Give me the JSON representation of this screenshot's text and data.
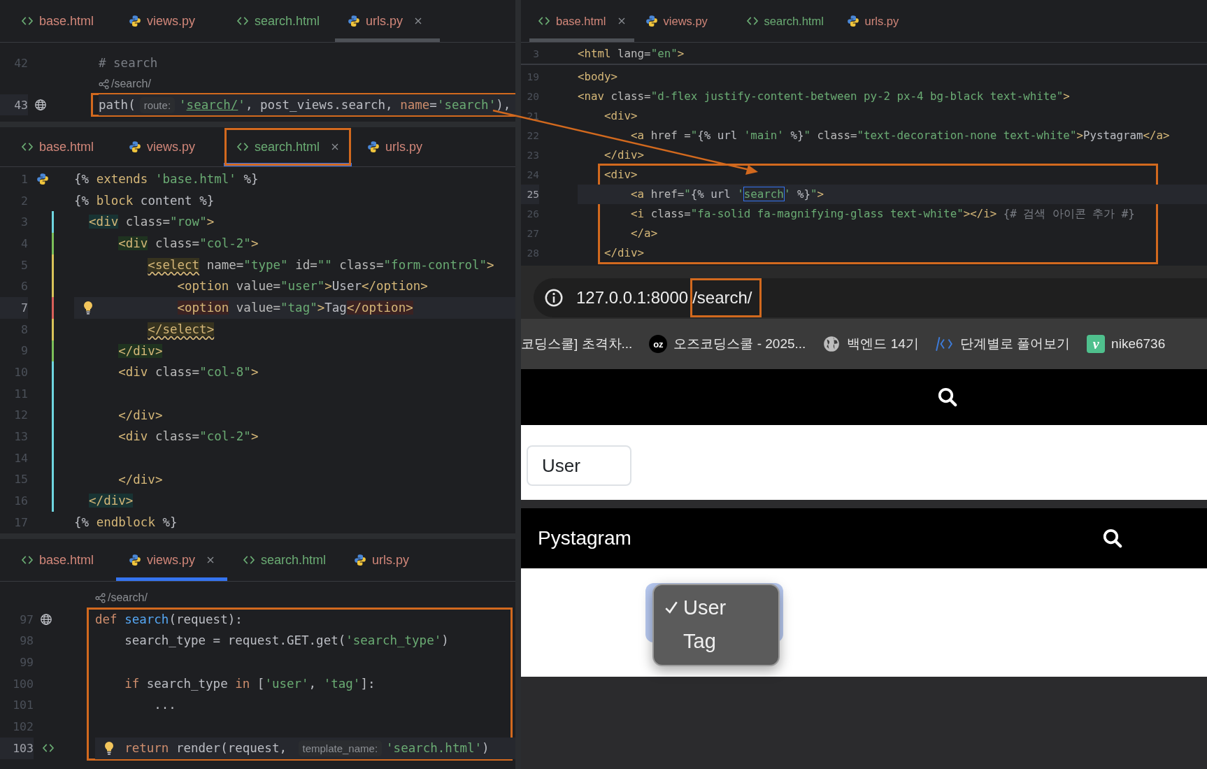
{
  "left_panes": [
    {
      "focused": false,
      "tabs": [
        {
          "label": "base.html",
          "kind": "html",
          "color": "#d2877a",
          "selected": false,
          "boxed": false
        },
        {
          "label": "views.py",
          "kind": "python",
          "color": "#d2877a",
          "selected": false,
          "boxed": false
        },
        {
          "label": "search.html",
          "kind": "html",
          "color": "#6aab73",
          "selected": false,
          "boxed": false
        },
        {
          "label": "urls.py",
          "kind": "python",
          "color": "#d2877a",
          "selected": true,
          "boxed": false
        }
      ],
      "blocks": [
        {
          "boxed": false,
          "lines": [
            {
              "num": "42",
              "current": false,
              "tokens": [
                {
                  "kind": "cmt",
                  "text": "# search"
                }
              ]
            },
            {
              "kind": "usage",
              "text": "/search/"
            }
          ]
        },
        {
          "boxed": true,
          "lines": [
            {
              "num": "43",
              "current": true,
              "markers": [
                {
                  "kind": "globe"
                }
              ],
              "tokens": [
                {
                  "kind": "plain",
                  "text": "path("
                },
                {
                  "kind": "hint",
                  "text": "route:"
                },
                {
                  "kind": "str",
                  "text": "'"
                },
                {
                  "kind": "str-u",
                  "text": "search/"
                },
                {
                  "kind": "str",
                  "text": "'"
                },
                {
                  "kind": "plain",
                  "text": ", post_views.search, "
                },
                {
                  "kind": "kw",
                  "text": "name"
                },
                {
                  "kind": "plain",
                  "text": "="
                },
                {
                  "kind": "str",
                  "text": "'search'"
                },
                {
                  "kind": "plain",
                  "text": "),"
                }
              ]
            }
          ]
        }
      ]
    },
    {
      "focused": true,
      "tabs": [
        {
          "label": "base.html",
          "kind": "html",
          "color": "#d2877a",
          "selected": false,
          "boxed": false
        },
        {
          "label": "views.py",
          "kind": "python",
          "color": "#d2877a",
          "selected": false,
          "boxed": false
        },
        {
          "label": "search.html",
          "kind": "html",
          "color": "#6aab73",
          "selected": true,
          "boxed": true
        },
        {
          "label": "urls.py",
          "kind": "python",
          "color": "#d2877a",
          "selected": false,
          "boxed": false
        }
      ],
      "blocks": [
        {
          "boxed": false,
          "lines": [
            {
              "num": "1",
              "current": false,
              "markers": [
                {
                  "kind": "python"
                }
              ],
              "tokens": [
                {
                  "kind": "plain",
                  "text": "{%"
                },
                {
                  "kind": "tag",
                  "text": " extends"
                },
                {
                  "kind": "str",
                  "text": " 'base.html'"
                },
                {
                  "kind": "plain",
                  "text": " %}"
                }
              ]
            },
            {
              "num": "2",
              "current": false,
              "tokens": [
                {
                  "kind": "plain",
                  "text": "{%"
                },
                {
                  "kind": "tag",
                  "text": " block"
                },
                {
                  "kind": "plain",
                  "text": " content %}"
                }
              ]
            },
            {
              "num": "3",
              "current": false,
              "color": "#6fd6e0",
              "tokens": [
                {
                  "kind": "tag-teal",
                  "text": "  <div"
                },
                {
                  "kind": "attr",
                  "text": " class="
                },
                {
                  "kind": "str",
                  "text": "\"row\""
                },
                {
                  "kind": "tag",
                  "text": ">"
                }
              ]
            },
            {
              "num": "4",
              "current": false,
              "color": "#7cbf5a",
              "tokens": [
                {
                  "kind": "tag-green",
                  "text": "      <div"
                },
                {
                  "kind": "attr",
                  "text": " class="
                },
                {
                  "kind": "str",
                  "text": "\"col-2\""
                },
                {
                  "kind": "tag",
                  "text": ">"
                }
              ]
            },
            {
              "num": "5",
              "current": false,
              "color": "#d9c45a",
              "tokens": [
                {
                  "kind": "tag-olive",
                  "text": "          <select"
                },
                {
                  "kind": "attr",
                  "text": " name="
                },
                {
                  "kind": "str",
                  "text": "\"type\""
                },
                {
                  "kind": "attr",
                  "text": " id="
                },
                {
                  "kind": "str",
                  "text": "\"\""
                },
                {
                  "kind": "attr",
                  "text": " class="
                },
                {
                  "kind": "str",
                  "text": "\"form-control\""
                },
                {
                  "kind": "tag",
                  "text": ">"
                }
              ]
            },
            {
              "num": "6",
              "current": false,
              "color": "#d9c45a",
              "tokens": [
                {
                  "kind": "tag",
                  "text": "              <option"
                },
                {
                  "kind": "attr",
                  "text": " value="
                },
                {
                  "kind": "str",
                  "text": "\"user\""
                },
                {
                  "kind": "tag",
                  "text": ">"
                },
                {
                  "kind": "plain",
                  "text": "User"
                },
                {
                  "kind": "tag",
                  "text": "</option>"
                }
              ]
            },
            {
              "num": "7",
              "current": true,
              "color": "#d9605a",
              "markers": [
                {
                  "kind": "bulb"
                }
              ],
              "tokens": [
                {
                  "kind": "tag-red",
                  "text": "              <option"
                },
                {
                  "kind": "attr",
                  "text": " value="
                },
                {
                  "kind": "str",
                  "text": "\"tag\""
                },
                {
                  "kind": "tag",
                  "text": ">"
                },
                {
                  "kind": "plain",
                  "text": "Tag"
                },
                {
                  "kind": "tag-red",
                  "text": "</option>"
                }
              ]
            },
            {
              "num": "8",
              "current": false,
              "color": "#d9c45a",
              "tokens": [
                {
                  "kind": "tag-olive",
                  "text": "          </select>"
                }
              ]
            },
            {
              "num": "9",
              "current": false,
              "color": "#7cbf5a",
              "tokens": [
                {
                  "kind": "tag-green",
                  "text": "      </div>"
                }
              ]
            },
            {
              "num": "10",
              "current": false,
              "color": "#6fd6e0",
              "tokens": [
                {
                  "kind": "tag",
                  "text": "      <div"
                },
                {
                  "kind": "attr",
                  "text": " class="
                },
                {
                  "kind": "str",
                  "text": "\"col-8\""
                },
                {
                  "kind": "tag",
                  "text": ">"
                }
              ]
            },
            {
              "num": "11",
              "current": false,
              "color": "#6fd6e0"
            },
            {
              "num": "12",
              "current": false,
              "color": "#6fd6e0",
              "tokens": [
                {
                  "kind": "tag",
                  "text": "      </div>"
                }
              ]
            },
            {
              "num": "13",
              "current": false,
              "color": "#6fd6e0",
              "tokens": [
                {
                  "kind": "tag",
                  "text": "      <div"
                },
                {
                  "kind": "attr",
                  "text": " class="
                },
                {
                  "kind": "str",
                  "text": "\"col-2\""
                },
                {
                  "kind": "tag",
                  "text": ">"
                }
              ]
            },
            {
              "num": "14",
              "current": false,
              "color": "#6fd6e0"
            },
            {
              "num": "15",
              "current": false,
              "color": "#6fd6e0",
              "tokens": [
                {
                  "kind": "tag",
                  "text": "      </div>"
                }
              ]
            },
            {
              "num": "16",
              "current": false,
              "color": "#6fd6e0",
              "tokens": [
                {
                  "kind": "tag-teal",
                  "text": "  </div>"
                }
              ]
            },
            {
              "num": "17",
              "current": false,
              "tokens": [
                {
                  "kind": "plain",
                  "text": "{%"
                },
                {
                  "kind": "tag",
                  "text": " endblock"
                },
                {
                  "kind": "plain",
                  "text": " %}"
                }
              ]
            }
          ]
        }
      ]
    },
    {
      "focused": true,
      "tabs": [
        {
          "label": "base.html",
          "kind": "html",
          "color": "#d2877a",
          "selected": false,
          "boxed": false
        },
        {
          "label": "views.py",
          "kind": "python",
          "color": "#d2877a",
          "selected": true,
          "boxed": false
        },
        {
          "label": "search.html",
          "kind": "html",
          "color": "#6aab73",
          "selected": false,
          "boxed": false
        },
        {
          "label": "urls.py",
          "kind": "python",
          "color": "#d2877a",
          "selected": false,
          "boxed": false
        }
      ],
      "blocks": [
        {
          "lines": [
            {
              "kind": "usage",
              "text": "/search/"
            }
          ]
        },
        {
          "boxed": true,
          "lines": [
            {
              "num": "97",
              "current": false,
              "markers": [
                {
                  "kind": "globe"
                }
              ],
              "tokens": [
                {
                  "kind": "kw",
                  "text": "def"
                },
                {
                  "kind": "fn",
                  "text": " search"
                },
                {
                  "kind": "plain",
                  "text": "(request):"
                }
              ]
            },
            {
              "num": "98",
              "current": false,
              "tokens": [
                {
                  "kind": "plain",
                  "text": "    search_type = request.GET.get("
                },
                {
                  "kind": "str",
                  "text": "'search_type'"
                },
                {
                  "kind": "plain",
                  "text": ")"
                }
              ]
            },
            {
              "num": "99",
              "current": false
            },
            {
              "num": "100",
              "current": false,
              "tokens": [
                {
                  "kind": "kw",
                  "text": "    if"
                },
                {
                  "kind": "plain",
                  "text": " search_type "
                },
                {
                  "kind": "kw",
                  "text": "in"
                },
                {
                  "kind": "plain",
                  "text": " ["
                },
                {
                  "kind": "str",
                  "text": "'user'"
                },
                {
                  "kind": "plain",
                  "text": ", "
                },
                {
                  "kind": "str",
                  "text": "'tag'"
                },
                {
                  "kind": "plain",
                  "text": "]:"
                }
              ]
            },
            {
              "num": "101",
              "current": false,
              "tokens": [
                {
                  "kind": "plain",
                  "text": "        ..."
                }
              ]
            },
            {
              "num": "102",
              "current": false
            },
            {
              "num": "103",
              "current": true,
              "markers": [
                {
                  "kind": "html"
                },
                {
                  "kind": "bulb"
                }
              ],
              "tokens": [
                {
                  "kind": "kw",
                  "text": "    return"
                },
                {
                  "kind": "plain",
                  "text": " render(request, "
                },
                {
                  "kind": "hint",
                  "text": "template_name:"
                },
                {
                  "kind": "str",
                  "text": "'search.html'"
                },
                {
                  "kind": "plain",
                  "text": ")"
                }
              ]
            }
          ]
        }
      ]
    }
  ],
  "right_pane": {
    "focused": false,
    "tabs": [
      {
        "label": "base.html",
        "kind": "html",
        "color": "#d2877a",
        "selected": true,
        "boxed": false
      },
      {
        "label": "views.py",
        "kind": "python",
        "color": "#d2877a",
        "selected": false,
        "boxed": false
      },
      {
        "label": "search.html",
        "kind": "html",
        "color": "#6aab73",
        "selected": false,
        "boxed": false
      },
      {
        "label": "urls.py",
        "kind": "python",
        "color": "#d2877a",
        "selected": false,
        "boxed": false
      }
    ],
    "blocks": [
      {
        "boxed": false,
        "sticky": true,
        "lines": [
          {
            "num": "3",
            "current": false,
            "tokens": [
              {
                "kind": "tag",
                "text": "<html"
              },
              {
                "kind": "attr",
                "text": " lang="
              },
              {
                "kind": "str",
                "text": "\"en\""
              },
              {
                "kind": "tag",
                "text": ">"
              }
            ]
          }
        ]
      },
      {
        "boxed": false,
        "sticky": false,
        "lines": [
          {
            "num": "19",
            "current": false,
            "tokens": [
              {
                "kind": "tag",
                "text": "<body>"
              }
            ]
          },
          {
            "num": "20",
            "current": false,
            "tokens": [
              {
                "kind": "tag",
                "text": "<nav"
              },
              {
                "kind": "attr",
                "text": " class="
              },
              {
                "kind": "str",
                "text": "\"d-flex justify-content-between py-2 px-4 bg-black text-white\""
              },
              {
                "kind": "tag",
                "text": ">"
              }
            ]
          },
          {
            "num": "21",
            "current": false,
            "tokens": [
              {
                "kind": "tag",
                "text": "    <div>"
              }
            ]
          },
          {
            "num": "22",
            "current": false,
            "tokens": [
              {
                "kind": "tag",
                "text": "        <a"
              },
              {
                "kind": "attr",
                "text": " href ="
              },
              {
                "kind": "str",
                "text": "\""
              },
              {
                "kind": "plain",
                "text": "{% url "
              },
              {
                "kind": "str",
                "text": "'main'"
              },
              {
                "kind": "plain",
                "text": " %}"
              },
              {
                "kind": "str",
                "text": "\""
              },
              {
                "kind": "attr",
                "text": " class="
              },
              {
                "kind": "str",
                "text": "\"text-decoration-none text-white\""
              },
              {
                "kind": "tag",
                "text": ">"
              },
              {
                "kind": "plain",
                "text": "Pystagram"
              },
              {
                "kind": "tag",
                "text": "</a>"
              }
            ]
          },
          {
            "num": "23",
            "current": false,
            "tokens": [
              {
                "kind": "tag",
                "text": "    </div>"
              }
            ]
          }
        ]
      },
      {
        "boxed": true,
        "sticky": false,
        "lines": [
          {
            "num": "24",
            "current": false,
            "tokens": [
              {
                "kind": "tag",
                "text": "    <div>"
              }
            ]
          },
          {
            "num": "25",
            "current": true,
            "tokens": [
              {
                "kind": "tag",
                "text": "        <a"
              },
              {
                "kind": "attr",
                "text": " href="
              },
              {
                "kind": "str",
                "text": "\""
              },
              {
                "kind": "plain",
                "text": "{% url "
              },
              {
                "kind": "str",
                "text": "'"
              },
              {
                "kind": "sel",
                "text": "search"
              },
              {
                "kind": "str",
                "text": "'"
              },
              {
                "kind": "plain",
                "text": " %}"
              },
              {
                "kind": "str",
                "text": "\""
              },
              {
                "kind": "tag",
                "text": ">"
              }
            ]
          },
          {
            "num": "26",
            "current": false,
            "tokens": [
              {
                "kind": "tag",
                "text": "        <i"
              },
              {
                "kind": "attr",
                "text": " class="
              },
              {
                "kind": "str",
                "text": "\"fa-solid fa-magnifying-glass text-white\""
              },
              {
                "kind": "tag",
                "text": "></i>"
              },
              {
                "kind": "cmt",
                "text": " {# 검색 아이콘 추가 #}"
              }
            ]
          },
          {
            "num": "27",
            "current": false,
            "tokens": [
              {
                "kind": "tag",
                "text": "        </a>"
              }
            ]
          },
          {
            "num": "28",
            "current": false,
            "tokens": [
              {
                "kind": "tag",
                "text": "    </div>"
              }
            ]
          }
        ]
      }
    ]
  },
  "browser": {
    "url_parts": [
      {
        "text": "127.0.0.1:8000",
        "boxed": false
      },
      {
        "text": "/search/",
        "boxed": true
      }
    ],
    "bookmarks": [
      {
        "label": "코딩스쿨] 초격차...",
        "kind": "plain"
      },
      {
        "label": "오즈코딩스쿨 - 2025...",
        "kind": "badge",
        "icon_text": "oz"
      },
      {
        "label": "백엔드 14기",
        "kind": "globe"
      },
      {
        "label": "단계별로 풀어보기",
        "kind": "code"
      },
      {
        "label": "nike6736",
        "kind": "letter",
        "icon_text": "v"
      }
    ],
    "pages": [
      {
        "content": {
          "kind": "select",
          "value": "User"
        }
      },
      {
        "brand": "Pystagram",
        "content": {
          "kind": "dropdown",
          "options": [
            {
              "label": "User",
              "selected": true
            },
            {
              "label": "Tag",
              "selected": false
            }
          ]
        }
      }
    ]
  }
}
